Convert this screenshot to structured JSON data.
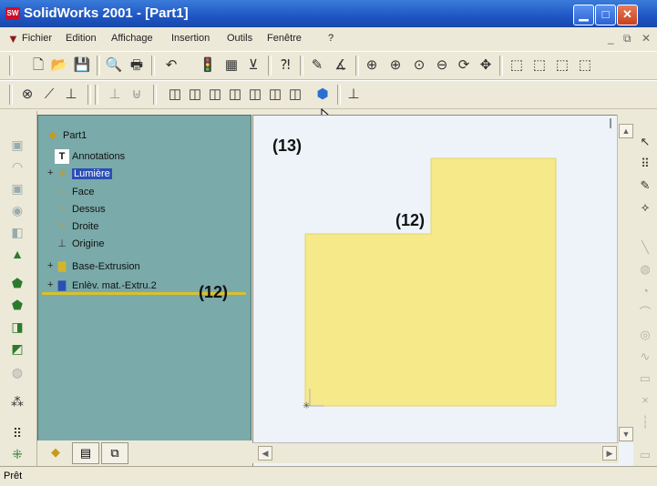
{
  "window": {
    "logo": "SW",
    "title": "SolidWorks 2001 - [Part1]",
    "minimize": "▁",
    "maximize": "□",
    "close": "✕"
  },
  "menu": {
    "items": [
      "Fichier",
      "Edition",
      "Affichage",
      "Insertion",
      "Outils",
      "Fenêtre",
      "?"
    ],
    "doc_controls": [
      "_",
      "⧉",
      "✕"
    ]
  },
  "toolbar_standard": {
    "icons": [
      "new-icon",
      "open-icon",
      "save-icon",
      "print-preview-icon",
      "print-icon",
      "undo-icon",
      "rebuild-icon",
      "options-icon",
      "filter-icon",
      "help-icon",
      "sketch-icon",
      "smart-dimension-icon",
      "zoom-fit-icon",
      "zoom-area-icon",
      "zoom-in-out-icon",
      "zoom-selection-icon",
      "rotate-icon",
      "pan-icon",
      "wireframe-icon",
      "hidden-lines-icon",
      "hidden-removed-icon",
      "shaded-icon"
    ]
  },
  "toolbar_view": {
    "icons": [
      "select-filter-icon",
      "line-icon",
      "axis-icon",
      "plane-icon",
      "grid-icon",
      "front-view-icon",
      "back-view-icon",
      "left-view-icon",
      "right-view-icon",
      "top-view-icon",
      "bottom-view-icon",
      "isometric-view-icon",
      "normal-to-icon"
    ]
  },
  "feature_tree": {
    "root": "Part1",
    "items": [
      {
        "label": "Annotations",
        "icon": "annotations-icon",
        "expandable": false
      },
      {
        "label": "Lumière",
        "icon": "lights-icon",
        "expandable": true,
        "selected": true
      },
      {
        "label": "Face",
        "icon": "plane-icon",
        "expandable": false
      },
      {
        "label": "Dessus",
        "icon": "plane-icon",
        "expandable": false
      },
      {
        "label": "Droite",
        "icon": "plane-icon",
        "expandable": false
      },
      {
        "label": "Origine",
        "icon": "origin-icon",
        "expandable": false
      },
      {
        "label": "Base-Extrusion",
        "icon": "extrude-icon",
        "expandable": true
      },
      {
        "label": "Enlèv. mat.-Extru.2",
        "icon": "cut-extrude-icon",
        "expandable": true
      }
    ],
    "tabs": [
      "feature-manager-tab",
      "property-manager-tab",
      "configuration-manager-tab"
    ]
  },
  "callouts": {
    "toolbar_button": "(13)",
    "part": "(12)",
    "rollback": "(12)"
  },
  "part": {
    "fill_color": "#f5e98a",
    "edge_color": "#e3d46a"
  },
  "statusbar": {
    "text": "Prêt"
  }
}
